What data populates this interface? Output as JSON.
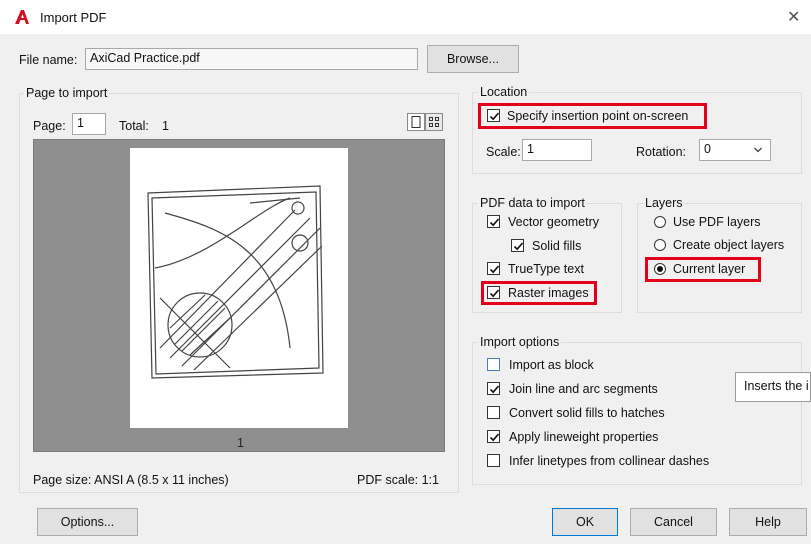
{
  "window": {
    "title": "Import PDF",
    "close_glyph": "✕"
  },
  "file": {
    "label": "File name:",
    "value": "AxiCad Practice.pdf",
    "browse_label": "Browse..."
  },
  "page_to_import": {
    "group_title": "Page to import",
    "page_label": "Page:",
    "page_value": "1",
    "total_label": "Total:",
    "total_value": "1",
    "thumbnail_page_number": "1",
    "page_size_text": "Page size: ANSI A (8.5 x 11 inches)",
    "pdf_scale_text": "PDF scale: 1:1"
  },
  "location": {
    "group_title": "Location",
    "specify_label": "Specify insertion point on-screen",
    "specify_checked": true,
    "scale_label": "Scale:",
    "scale_value": "1",
    "rotation_label": "Rotation:",
    "rotation_value": "0"
  },
  "pdf_data": {
    "group_title": "PDF data to import",
    "vector_label": "Vector geometry",
    "solid_fills_label": "Solid fills",
    "truetype_label": "TrueType text",
    "raster_label": "Raster images"
  },
  "layers": {
    "group_title": "Layers",
    "use_pdf_label": "Use PDF layers",
    "create_object_label": "Create object layers",
    "current_label": "Current layer",
    "selected": "Current layer"
  },
  "import_options": {
    "group_title": "Import options",
    "import_block_label": "Import as block",
    "join_label": "Join line and arc segments",
    "convert_label": "Convert solid fills to hatches",
    "lineweight_label": "Apply lineweight properties",
    "infer_label": "Infer linetypes from collinear dashes"
  },
  "tooltip_text": "Inserts the i",
  "buttons": {
    "options": "Options...",
    "ok": "OK",
    "cancel": "Cancel",
    "help": "Help"
  },
  "colors": {
    "highlight_red": "#e2001a",
    "app_icon_red": "#d01020"
  }
}
